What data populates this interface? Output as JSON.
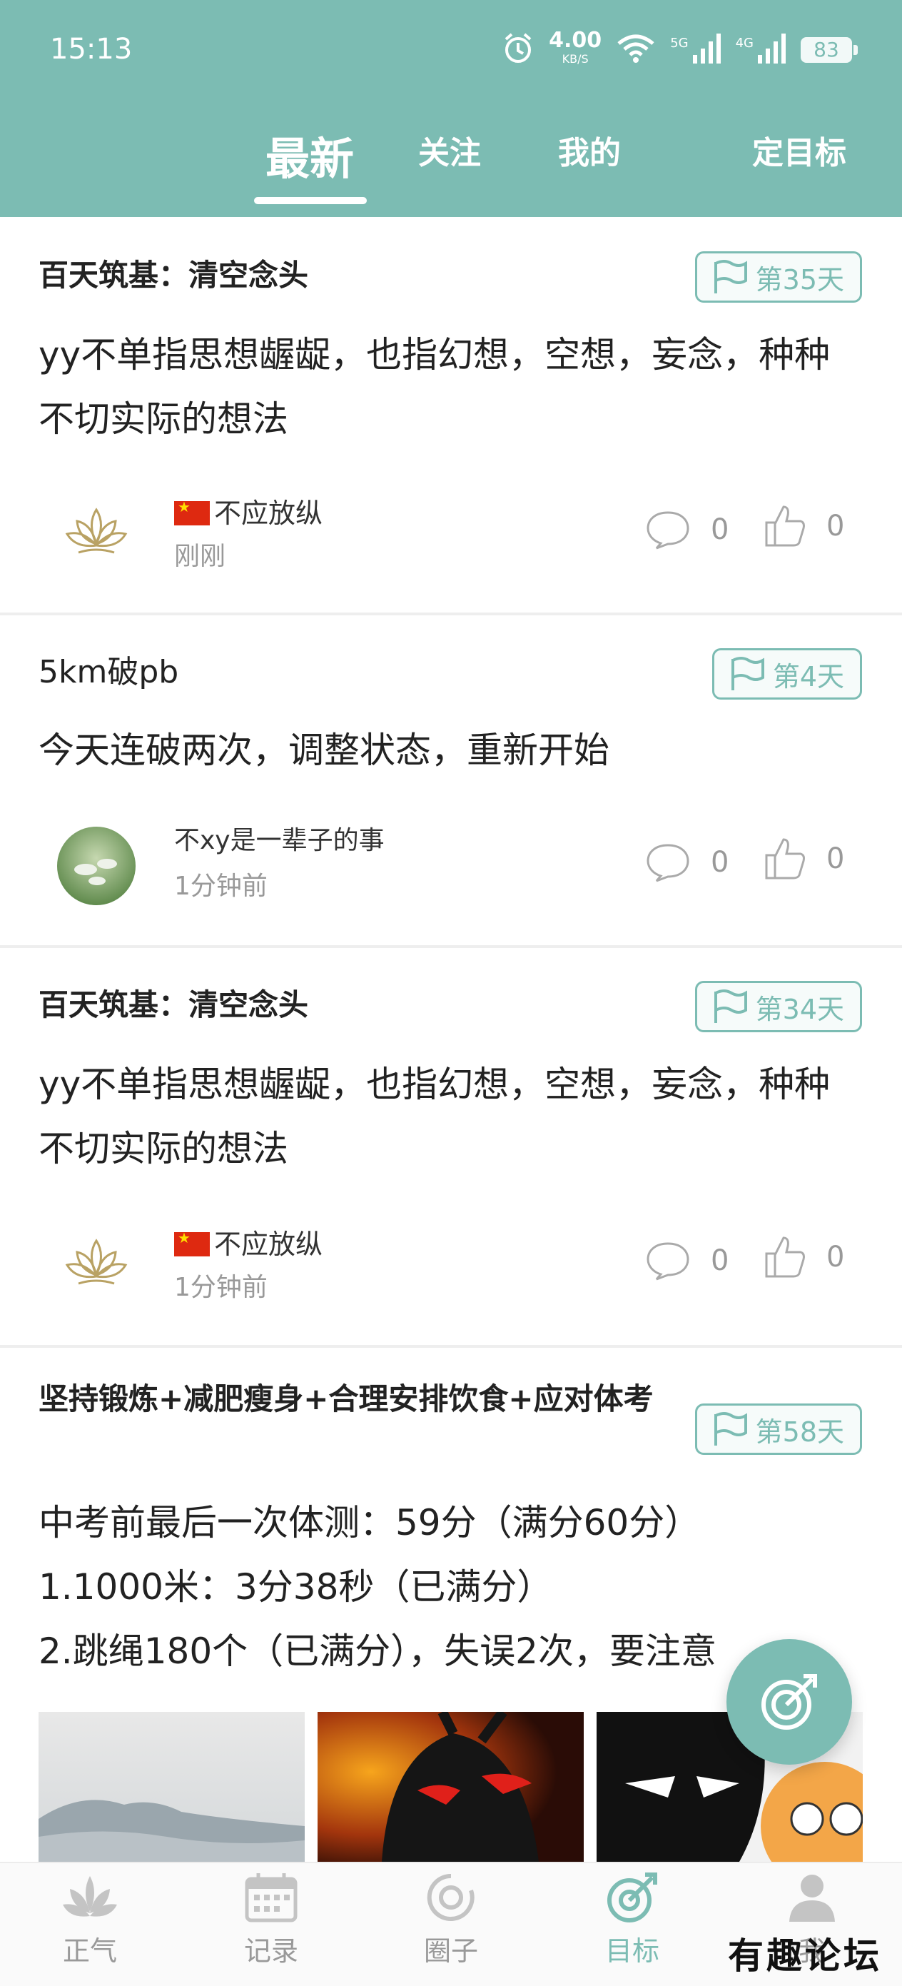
{
  "status_bar": {
    "time": "15:13",
    "net_speed": "4.00",
    "net_unit": "KB/S",
    "sig1_label": "5G",
    "sig2_label": "4G",
    "battery": "83"
  },
  "tabs": {
    "latest": "最新",
    "following": "关注",
    "mine": "我的",
    "set_goal": "定目标"
  },
  "posts": [
    {
      "title": "百天筑基：清空念头",
      "badge": "第35天",
      "body": "yy不单指思想龌龊，也指幻想，空想，妄念，种种不切实际的想法",
      "user": "不应放纵",
      "time": "刚刚",
      "comments": "0",
      "likes": "0"
    },
    {
      "title": "5km破pb",
      "badge": "第4天",
      "body": "今天连破两次，调整状态，重新开始",
      "user": "不xy是一辈子的事",
      "time": "1分钟前",
      "comments": "0",
      "likes": "0"
    },
    {
      "title": "百天筑基：清空念头",
      "badge": "第34天",
      "body": "yy不单指思想龌龊，也指幻想，空想，妄念，种种不切实际的想法",
      "user": "不应放纵",
      "time": "1分钟前",
      "comments": "0",
      "likes": "0"
    },
    {
      "title": "坚持锻炼+减肥瘦身+合理安排饮食+应对体考",
      "badge": "第58天",
      "body_lines": [
        "中考前最后一次体测：59分（满分60分）",
        "1.1000米：3分38秒（已满分）",
        "2.跳绳180个（已满分），失误2次，要注意"
      ]
    }
  ],
  "bottom_nav": {
    "zhengqi": "正气",
    "record": "记录",
    "circle": "圈子",
    "goal": "目标",
    "me": "我"
  },
  "watermark": "有趣论坛",
  "colors": {
    "accent": "#7cbcb3",
    "divider": "#eeeeee"
  }
}
